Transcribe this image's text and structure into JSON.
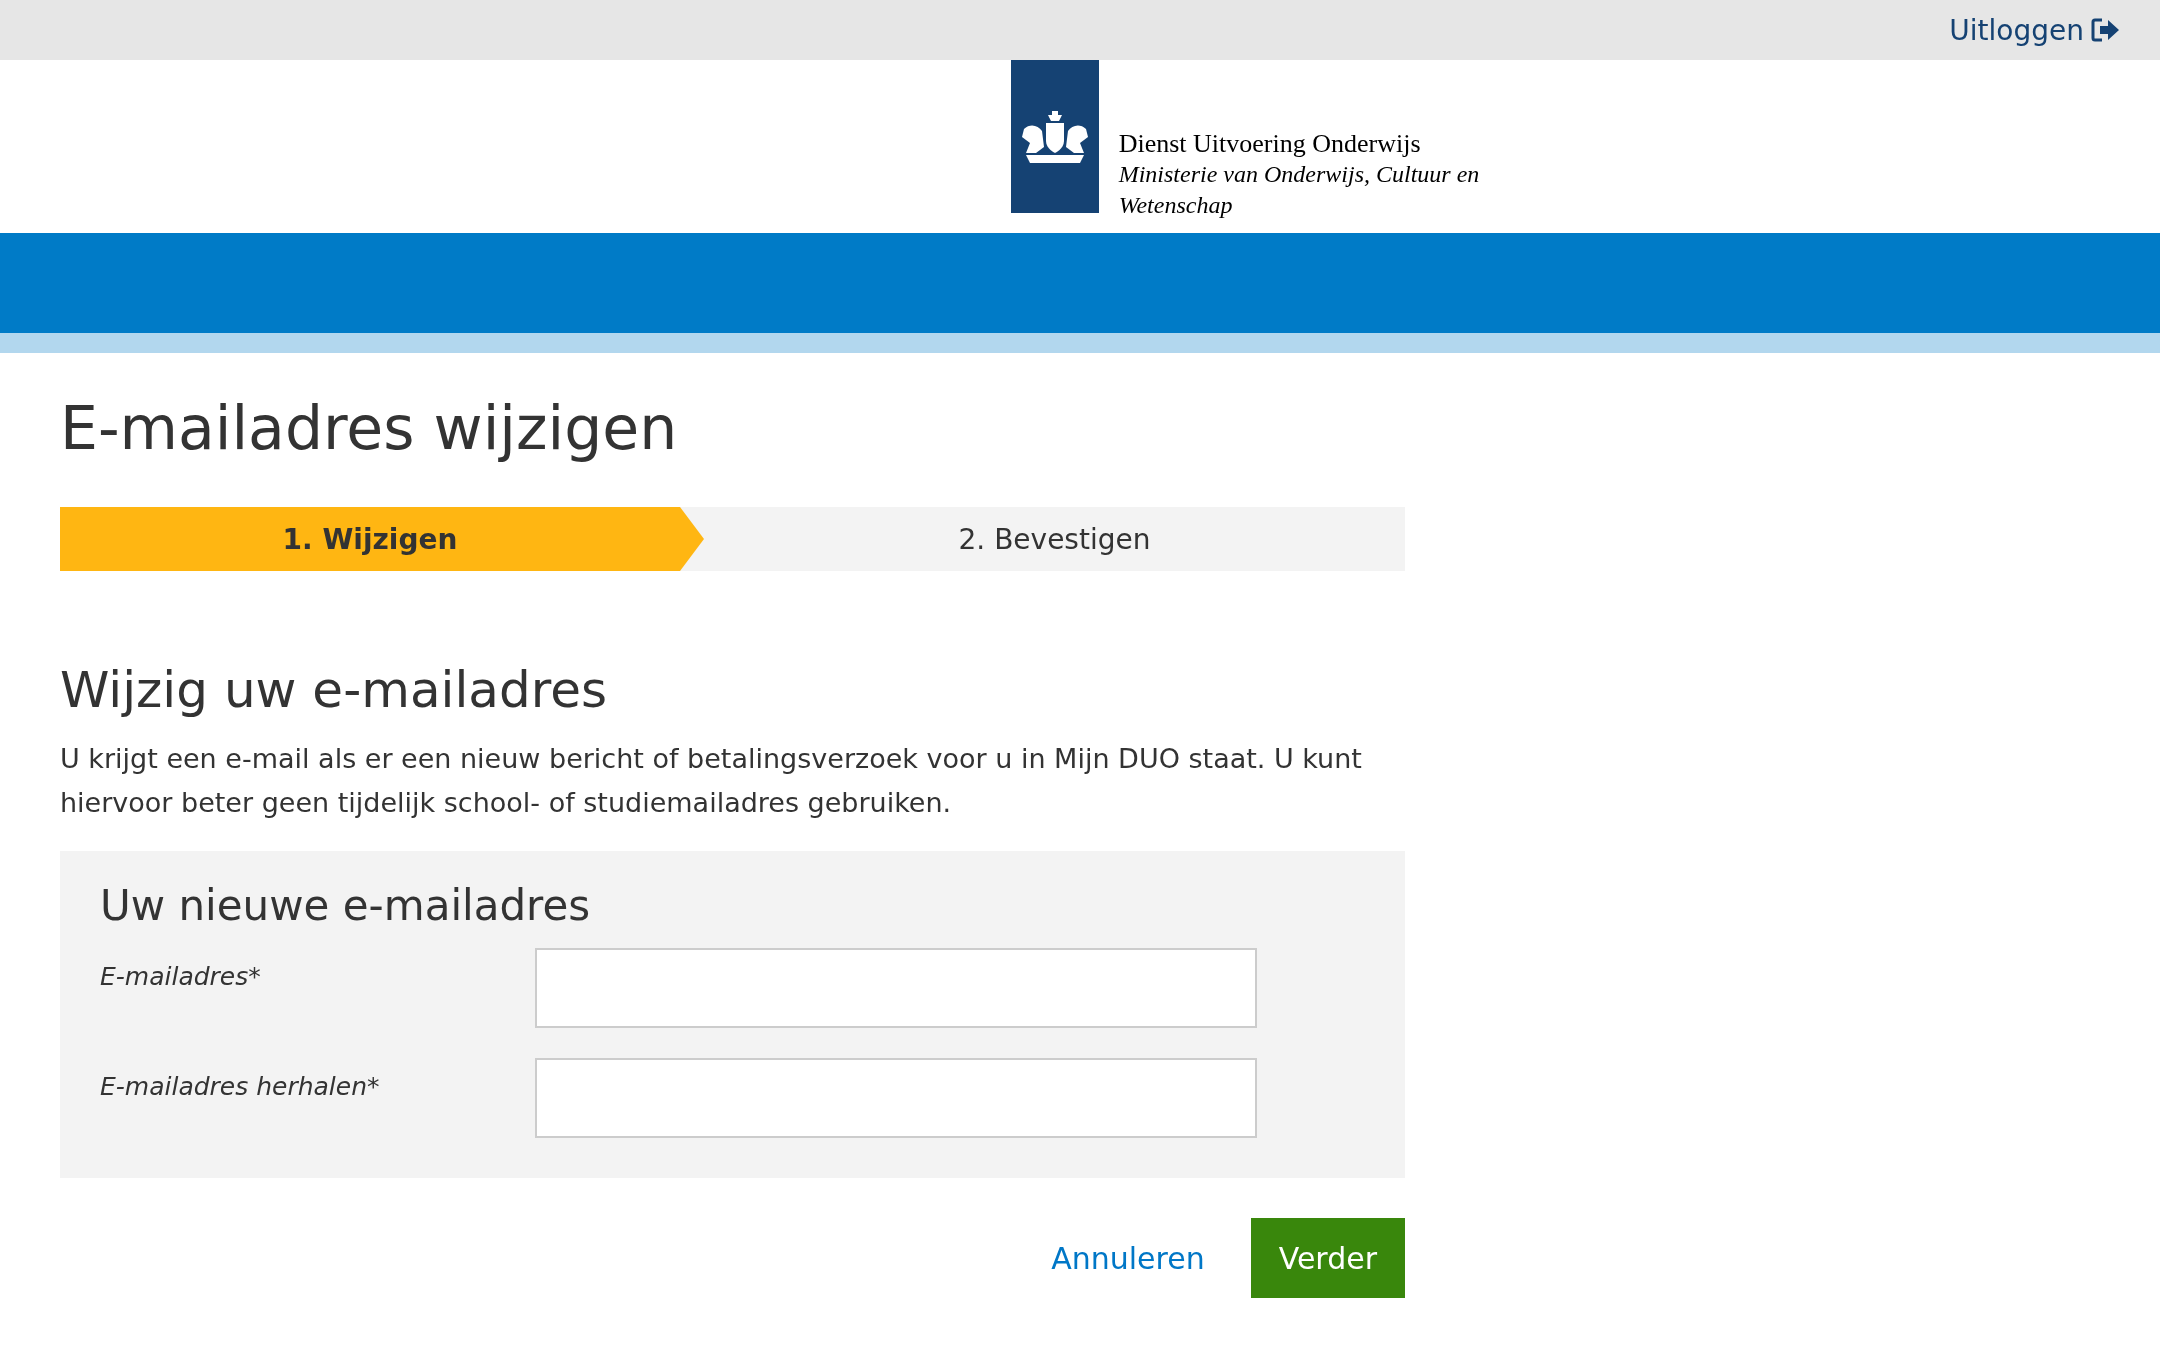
{
  "top_bar": {
    "logout_link": "Uitloggen"
  },
  "header": {
    "organisation": "Dienst Uitvoering Onderwijs",
    "ministry_line_1": "Ministerie van Onderwijs, Cultuur en",
    "ministry_line_2": "Wetenschap"
  },
  "page_title": "E-mailadres wijzigen",
  "steps": [
    {
      "label": "1. Wijzigen",
      "selected": true
    },
    {
      "label": "2. Bevestigen",
      "selected": false
    }
  ],
  "section_title": "Wijzig uw e-mailadres",
  "intro": "U krijgt een e-mail als er een nieuw bericht of betalingsverzoek voor u in Mijn DUO staat. U kunt hiervoor beter geen tijdelijk school- of studiemailadres gebruiken.",
  "form": {
    "title": "Uw nieuwe e-mailadres",
    "fields": [
      {
        "label": "E-mailadres*"
      },
      {
        "label": "E-mailadres herhalen*"
      }
    ]
  },
  "actions": {
    "cancel": "Annuleren",
    "next": "Verder"
  }
}
